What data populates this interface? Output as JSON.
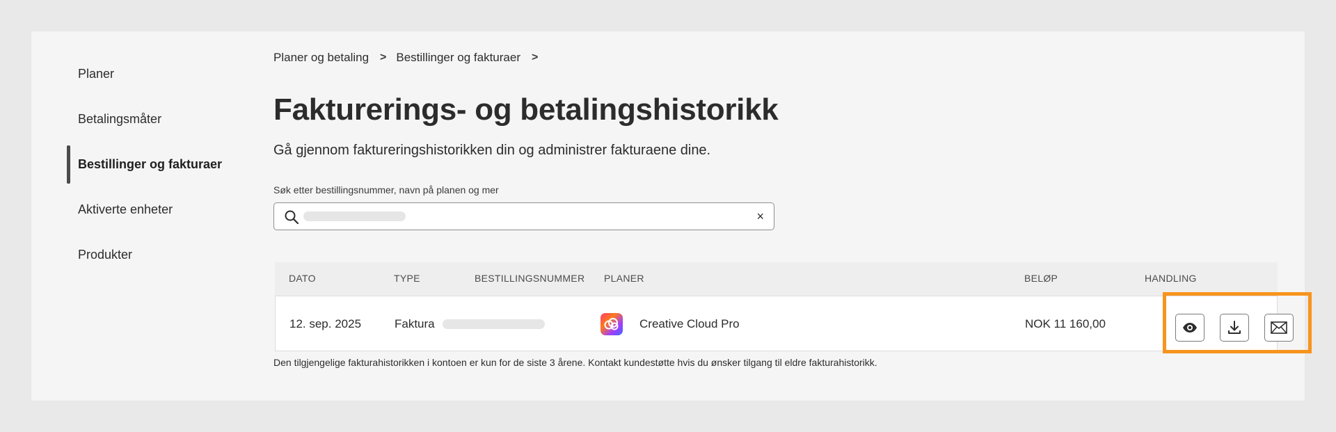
{
  "sidebar": {
    "items": [
      {
        "label": "Planer"
      },
      {
        "label": "Betalingsmåter"
      },
      {
        "label": "Bestillinger og fakturaer",
        "active": true
      },
      {
        "label": "Aktiverte enheter"
      },
      {
        "label": "Produkter"
      }
    ]
  },
  "breadcrumb": {
    "items": [
      "Planer og betaling",
      "Bestillinger og fakturaer"
    ],
    "separator": ">"
  },
  "page": {
    "title": "Fakturerings- og betalingshistorikk",
    "subtitle": "Gå gjennom faktureringshistorikken din og administrer fakturaene dine."
  },
  "search": {
    "label": "Søk etter bestillingsnummer, navn på planen og mer",
    "value": "",
    "clear_symbol": "×"
  },
  "table": {
    "headers": {
      "date": "DATO",
      "type": "TYPE",
      "order_number": "BESTILLINGSNUMMER",
      "plans": "PLANER",
      "amount": "BELØP",
      "action": "HANDLING"
    },
    "rows": [
      {
        "date": "12. sep. 2025",
        "type": "Faktura",
        "plan": "Creative Cloud Pro",
        "plan_icon": "creative-cloud-icon",
        "amount": "NOK 11 160,00",
        "actions": [
          "eye-icon",
          "download-icon",
          "mail-icon"
        ]
      }
    ]
  },
  "footnote": "Den tilgjengelige fakturahistorikken i kontoen er kun for de siste 3 årene. Kontakt kundestøtte hvis du ønsker tilgang til eldre fakturahistorikk.",
  "colors": {
    "highlight": "#f7941d",
    "background": "#e9e9e9",
    "panel": "#f5f5f5"
  }
}
